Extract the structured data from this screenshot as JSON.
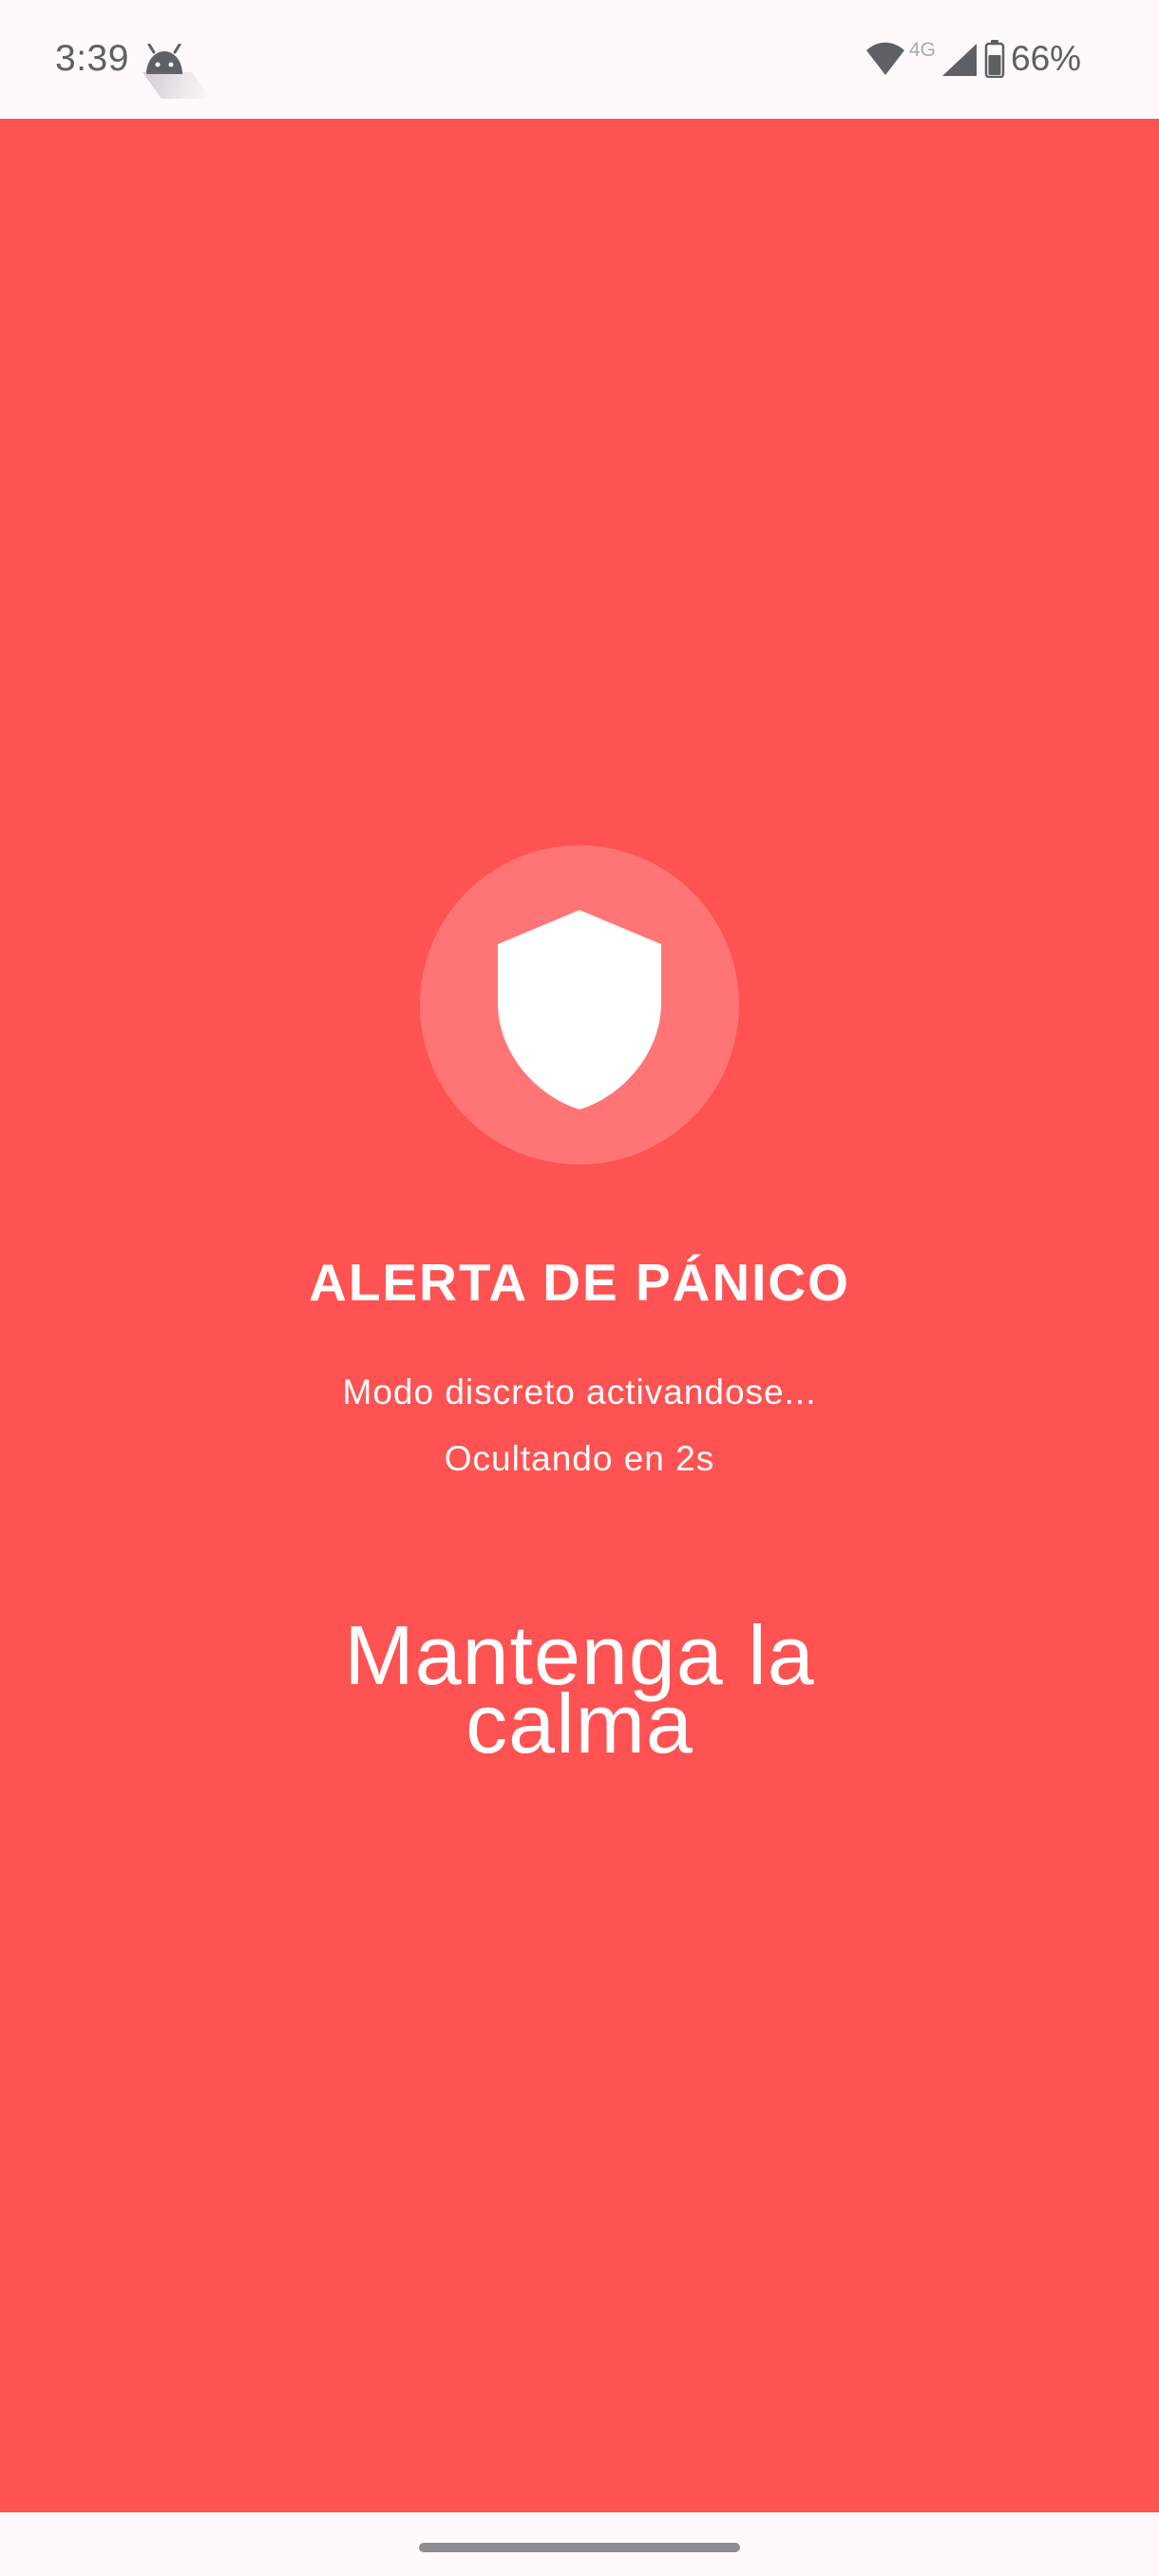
{
  "status_bar": {
    "time": "3:39",
    "network": "4G",
    "battery": "66%",
    "icons": [
      "android-icon",
      "wifi-icon",
      "signal-icon",
      "battery-icon"
    ]
  },
  "panic_screen": {
    "icon": "shield-icon",
    "title": "ALERTA DE PÁNICO",
    "status_line": "Modo discreto activandose...",
    "countdown_line": "Ocultando en 2s",
    "message": "Mantenga la calma"
  },
  "colors": {
    "background": "#FF5252",
    "circle": "#FF7575",
    "text": "#FFFFFF",
    "status_bar_bg": "#FFF9FC"
  },
  "nav": {
    "icon": "home-gesture-pill"
  }
}
